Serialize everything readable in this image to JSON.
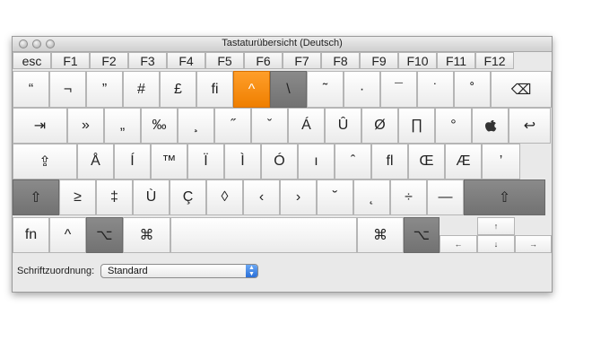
{
  "window": {
    "title": "Tastaturübersicht (Deutsch)"
  },
  "function_row": [
    "esc",
    "F1",
    "F2",
    "F3",
    "F4",
    "F5",
    "F6",
    "F7",
    "F8",
    "F9",
    "F10",
    "F11",
    "F12"
  ],
  "row1": [
    "“",
    "¬",
    "”",
    "#",
    "£",
    "ﬁ",
    "^",
    "\\",
    "˜",
    "·",
    "¯",
    "˙",
    "˚",
    "⌫"
  ],
  "row2": [
    "⇥",
    "»",
    "„",
    "‰",
    "¸",
    "˝",
    "ˇ",
    "Á",
    "Û",
    "Ø",
    "∏",
    "°",
    "",
    "↩"
  ],
  "row3": [
    "⇪",
    "Å",
    "Í",
    "™",
    "Ï",
    "Ì",
    "Ó",
    "ı",
    "ˆ",
    "ﬂ",
    "Œ",
    "Æ",
    "’"
  ],
  "row4": [
    "⇧",
    "≥",
    "‡",
    "Ù",
    "Ç",
    "◊",
    "‹",
    "›",
    "˘",
    "˛",
    "÷",
    "—",
    "⇧"
  ],
  "row5": [
    "fn",
    "^",
    "⌥",
    "⌘",
    "",
    "⌘",
    "⌥"
  ],
  "arrows": {
    "up": "↑",
    "left": "←",
    "down": "↓",
    "right": "→"
  },
  "footer": {
    "label": "Schriftzuordnung:",
    "selected_value": "Standard",
    "stepper_up": "▲",
    "stepper_down": "▼"
  },
  "colors": {
    "highlight": "#f08300",
    "modifier": "#7d7d7d"
  }
}
